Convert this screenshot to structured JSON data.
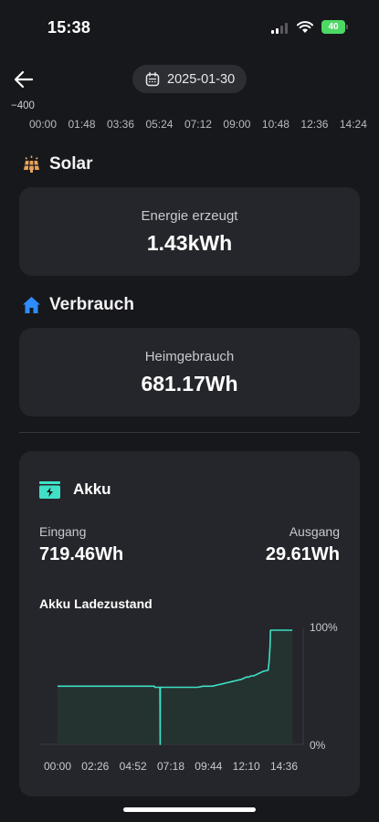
{
  "status_bar": {
    "time": "15:38",
    "battery": "40"
  },
  "header": {
    "date": "2025-01-30"
  },
  "top_chart": {
    "y_label": "−400",
    "x_ticks": [
      "00:00",
      "01:48",
      "03:36",
      "05:24",
      "07:12",
      "09:00",
      "10:48",
      "12:36",
      "14:24"
    ]
  },
  "solar": {
    "title": "Solar",
    "label": "Energie erzeugt",
    "value": "1.43kWh"
  },
  "verbrauch": {
    "title": "Verbrauch",
    "label": "Heimgebrauch",
    "value": "681.17Wh"
  },
  "akku": {
    "title": "Akku",
    "eingang_label": "Eingang",
    "eingang_value": "719.46Wh",
    "ausgang_label": "Ausgang",
    "ausgang_value": "29.61Wh",
    "soc_title": "Akku Ladezustand"
  },
  "chart_data": {
    "type": "area",
    "title": "Akku Ladezustand",
    "x_ticks": [
      "00:00",
      "02:26",
      "04:52",
      "07:18",
      "09:44",
      "12:10",
      "14:36"
    ],
    "y_ticks": [
      "100%",
      "0%"
    ],
    "ylim": [
      0,
      100
    ],
    "xlim_minutes": [
      0,
      1000
    ],
    "x_minutes": [
      0,
      400,
      402,
      404,
      406,
      408,
      410,
      412,
      415,
      420,
      430,
      440,
      450,
      460,
      480,
      500,
      520,
      540,
      560,
      580,
      600,
      620,
      640,
      660,
      680,
      700,
      720,
      740,
      760,
      770,
      780,
      790,
      800,
      810,
      820,
      830,
      840,
      850,
      870,
      874,
      876,
      878,
      880,
      900,
      920,
      940,
      960,
      970
    ],
    "y_percent": [
      51,
      51,
      50,
      50,
      50,
      50,
      50,
      50,
      50,
      50,
      50,
      50,
      50,
      50,
      50,
      50,
      50,
      50,
      50,
      50,
      51,
      51,
      51,
      52,
      53,
      54,
      55,
      56,
      57,
      58,
      59,
      59,
      60,
      60,
      61,
      62,
      63,
      64,
      65,
      72,
      78,
      86,
      100,
      100,
      100,
      100,
      100,
      100
    ],
    "dip_minutes": 424,
    "dip_value": 0,
    "colors": {
      "line": "#3fe0c6",
      "fill": "#243330",
      "axis": "#3a3b40"
    }
  },
  "colors": {
    "background": "#17181c",
    "card": "#25262b",
    "accent": "#3fe0c6",
    "solar_icon": "#e8a25a",
    "home_icon": "#2f8cff"
  }
}
